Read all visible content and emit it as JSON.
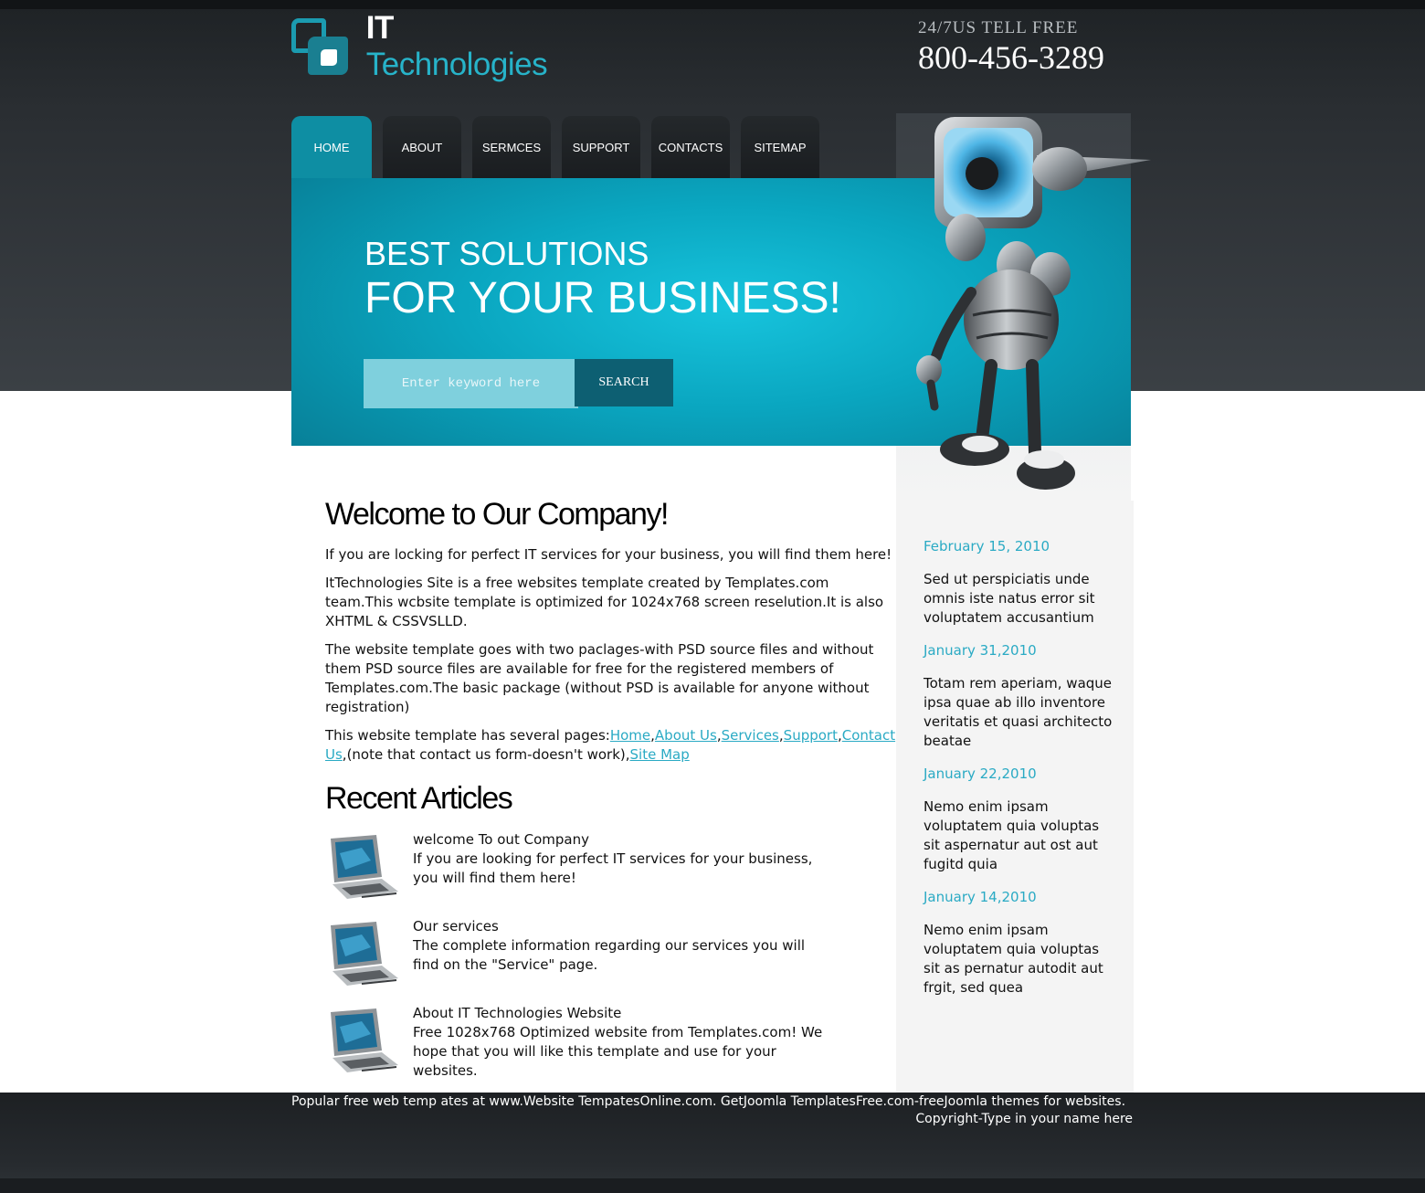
{
  "header": {
    "logo_it": "IT",
    "logo_tech": "Technologies",
    "phone_label": "24/7US TELL FREE",
    "phone_number": "800-456-3289"
  },
  "nav": {
    "items": [
      {
        "label": "HOME",
        "active": true
      },
      {
        "label": "ABOUT"
      },
      {
        "label": "SERMCES"
      },
      {
        "label": "SUPPORT"
      },
      {
        "label": "CONTACTS"
      },
      {
        "label": "SITEMAP"
      }
    ]
  },
  "hero": {
    "line1": "BEST SOLUTIONS",
    "line2": "FOR YOUR BUSINESS!",
    "search_placeholder": "Enter keyword here",
    "search_button": "SEARCH"
  },
  "main": {
    "welcome_title": "Welcome to Our Company!",
    "p1": "If you are locking for perfect IT services for your business, you will find them here!",
    "p2": "ItTechnologies Site is a free websites template created by Templates.com team.This wcbsite template is optimized for 1024x768 screen reselution.It is also XHTML & CSSVSLLD.",
    "p3": "The website template goes with two paclages-with PSD source files and without them PSD source files are available for free for the registered members of Templates.com.The basic package (without PSD is available for anyone without registration)",
    "p4_prefix": "This website template has several pages:",
    "links": [
      "Home",
      "About Us",
      "Services",
      "Support",
      "Contact Us"
    ],
    "p4_mid": ",(note that contact us form-doesn't work),",
    "sitemap_link": "Site Map",
    "recent_title": "Recent Articles",
    "articles": [
      {
        "title": "welcome To out Company",
        "text": "If you are looking for perfect IT services for your business, you will find them here!"
      },
      {
        "title": "Our services",
        "text": "The complete information regarding our services you will find on the \"Service\" page."
      },
      {
        "title": "About IT Technologies Website",
        "text": "Free 1028x768 Optimized website from Templates.com! We hope that you will like this template and use for your websites."
      }
    ]
  },
  "sidebar": {
    "news": [
      {
        "date": "February 15, 2010",
        "text": "Sed ut perspiciatis unde omnis iste natus error sit voluptatem accusantium"
      },
      {
        "date": "January 31,2010",
        "text": "Totam rem aperiam, waque ipsa quae ab illo inventore veritatis et quasi architecto beatae"
      },
      {
        "date": "January 22,2010",
        "text": "Nemo enim ipsam voluptatem quia voluptas sit aspernatur aut ost aut fugitd quia"
      },
      {
        "date": "January 14,2010",
        "text": "Nemo enim ipsam voluptatem quia voluptas sit as pernatur autodit aut frgit, sed quea"
      }
    ]
  },
  "footer": {
    "line1": "Popular free web temp ates at www.Website TempatesOnline.com. GetJoomla TemplatesFree.com-freeJoomla themes for websites.",
    "line2": "Copyright-Type in your name here"
  },
  "colors": {
    "accent": "#0e8ea3",
    "link": "#2aaac4",
    "dark_band": "#2a2e32",
    "sidebar_bg": "#f4f4f4"
  },
  "icons": [
    "logo-mark-icon",
    "robot-illustration",
    "laptop-icon"
  ]
}
